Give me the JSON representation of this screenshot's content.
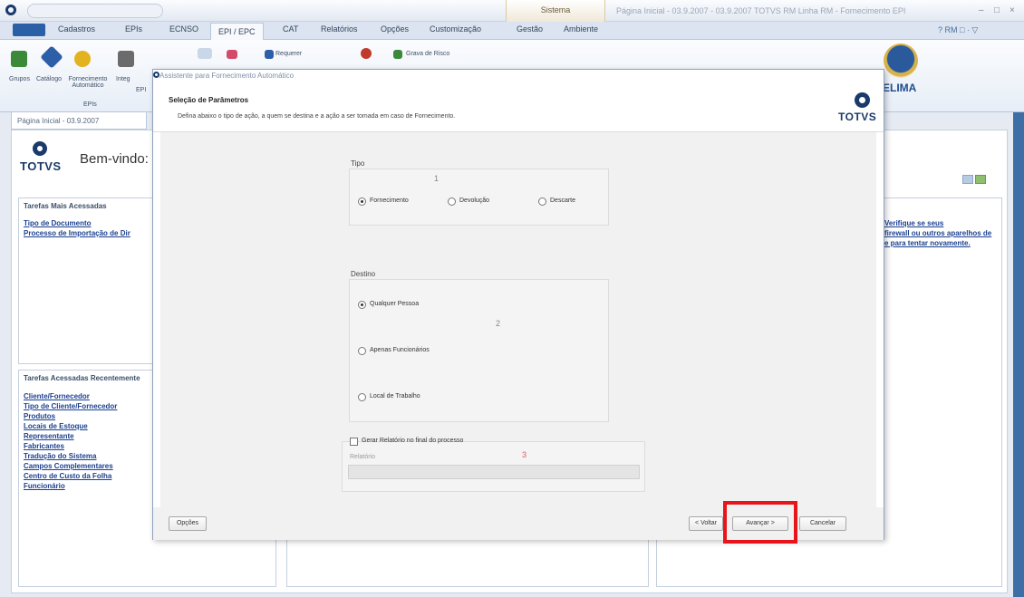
{
  "title_bar": {
    "context_tab": "Sistema",
    "window_title": "Página Inicial - 03.9.2007 - 03.9.2007 TOTVS RM Linha RM - Fornecimento EPI",
    "minimize": "–",
    "maximize": "□",
    "close": "×"
  },
  "ribbon_tabs": [
    "Cadastros",
    "EPIs",
    "ECNSO",
    "EPI / EPC",
    "CAT",
    "Relatórios",
    "Opções",
    "Customização",
    "Gestão",
    "Ambiente"
  ],
  "ribbon_tabs_right": "? RM  □ · ▽",
  "ribbon": {
    "buttons": [
      "Grupos",
      "Catálogo",
      "Fornecimento Automático",
      "Integ",
      "EPI"
    ],
    "small_items": [
      "Requerer",
      "Grava de Risco"
    ],
    "group_label": "EPIs"
  },
  "seal_text": "ELIMA",
  "doc_tab": "Página Inicial - 03.9.2007",
  "home": {
    "logo": "TOTVS",
    "welcome": "Bem-vindo: m",
    "favorites_title": "Tarefas Mais Acessadas",
    "favorites": [
      "Tipo de Documento",
      "Processo de Importação de Dir"
    ],
    "recent_title": "Tarefas Acessadas Recentemente",
    "recent": [
      "Cliente/Fornecedor",
      "Tipo de Cliente/Fornecedor",
      "Produtos",
      "Locais de Estoque",
      "Representante",
      "Fabricantes",
      "Tradução do Sistema",
      "Campos Complementares",
      "Centro de Custo da Folha",
      "Funcionário"
    ],
    "right_links": [
      "Verifique se seus",
      "firewall ou outros aparelhos de",
      "e para tentar novamente."
    ]
  },
  "dialog": {
    "title": "Assistente para Fornecimento Automático",
    "heading": "Seleção de Parâmetros",
    "description": "Defina abaixo o tipo de ação, a quem se destina e a ação a ser tomada em caso de Fornecimento.",
    "logo": "TOTVS",
    "tipo": {
      "label": "Tipo",
      "marker": "1",
      "options": [
        "Fornecimento",
        "Devolução",
        "Descarte"
      ],
      "selected": "Fornecimento"
    },
    "destino": {
      "label": "Destino",
      "marker": "2",
      "options": [
        "Qualquer Pessoa",
        "Apenas Funcionários",
        "Local de Trabalho"
      ],
      "selected": "Qualquer Pessoa"
    },
    "relatorio": {
      "checkbox_label": "Gerar Relatório no final do processo",
      "checked": false,
      "marker": "3",
      "field_label": "Relatório"
    },
    "buttons": {
      "options": "Opções",
      "back": "< Voltar",
      "next": "Avançar >",
      "cancel": "Cancelar"
    }
  }
}
